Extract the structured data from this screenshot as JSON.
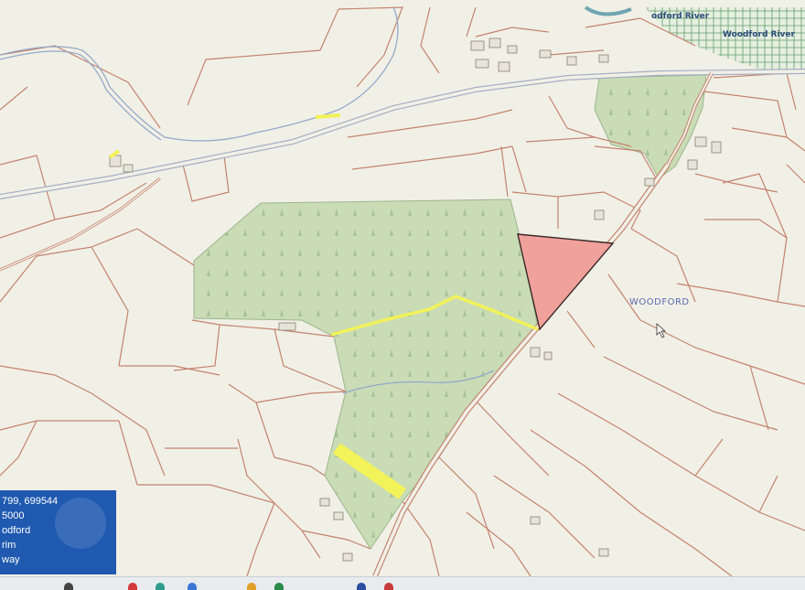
{
  "map": {
    "place_label": "WOODFORD",
    "river_label_1": "odford River",
    "river_label_2": "Woodford River",
    "colors": {
      "background": "#f1f0e6",
      "field_boundary": "#c4836f",
      "road": "#a5aec4",
      "woodland": "#c9dcb6",
      "selected_plot": "#f0a19c",
      "right_of_way": "#f2f259",
      "river_water": "#6fa6b0"
    }
  },
  "info_panel": {
    "line1": "799, 699544",
    "line2": "5000",
    "line3": "odford",
    "line4": "rim",
    "line5": "way"
  },
  "taskbar": {
    "icons": [
      "app-icon-1",
      "app-icon-2",
      "app-icon-3",
      "app-icon-4",
      "app-icon-5",
      "app-icon-6",
      "app-icon-7",
      "app-icon-8"
    ]
  }
}
